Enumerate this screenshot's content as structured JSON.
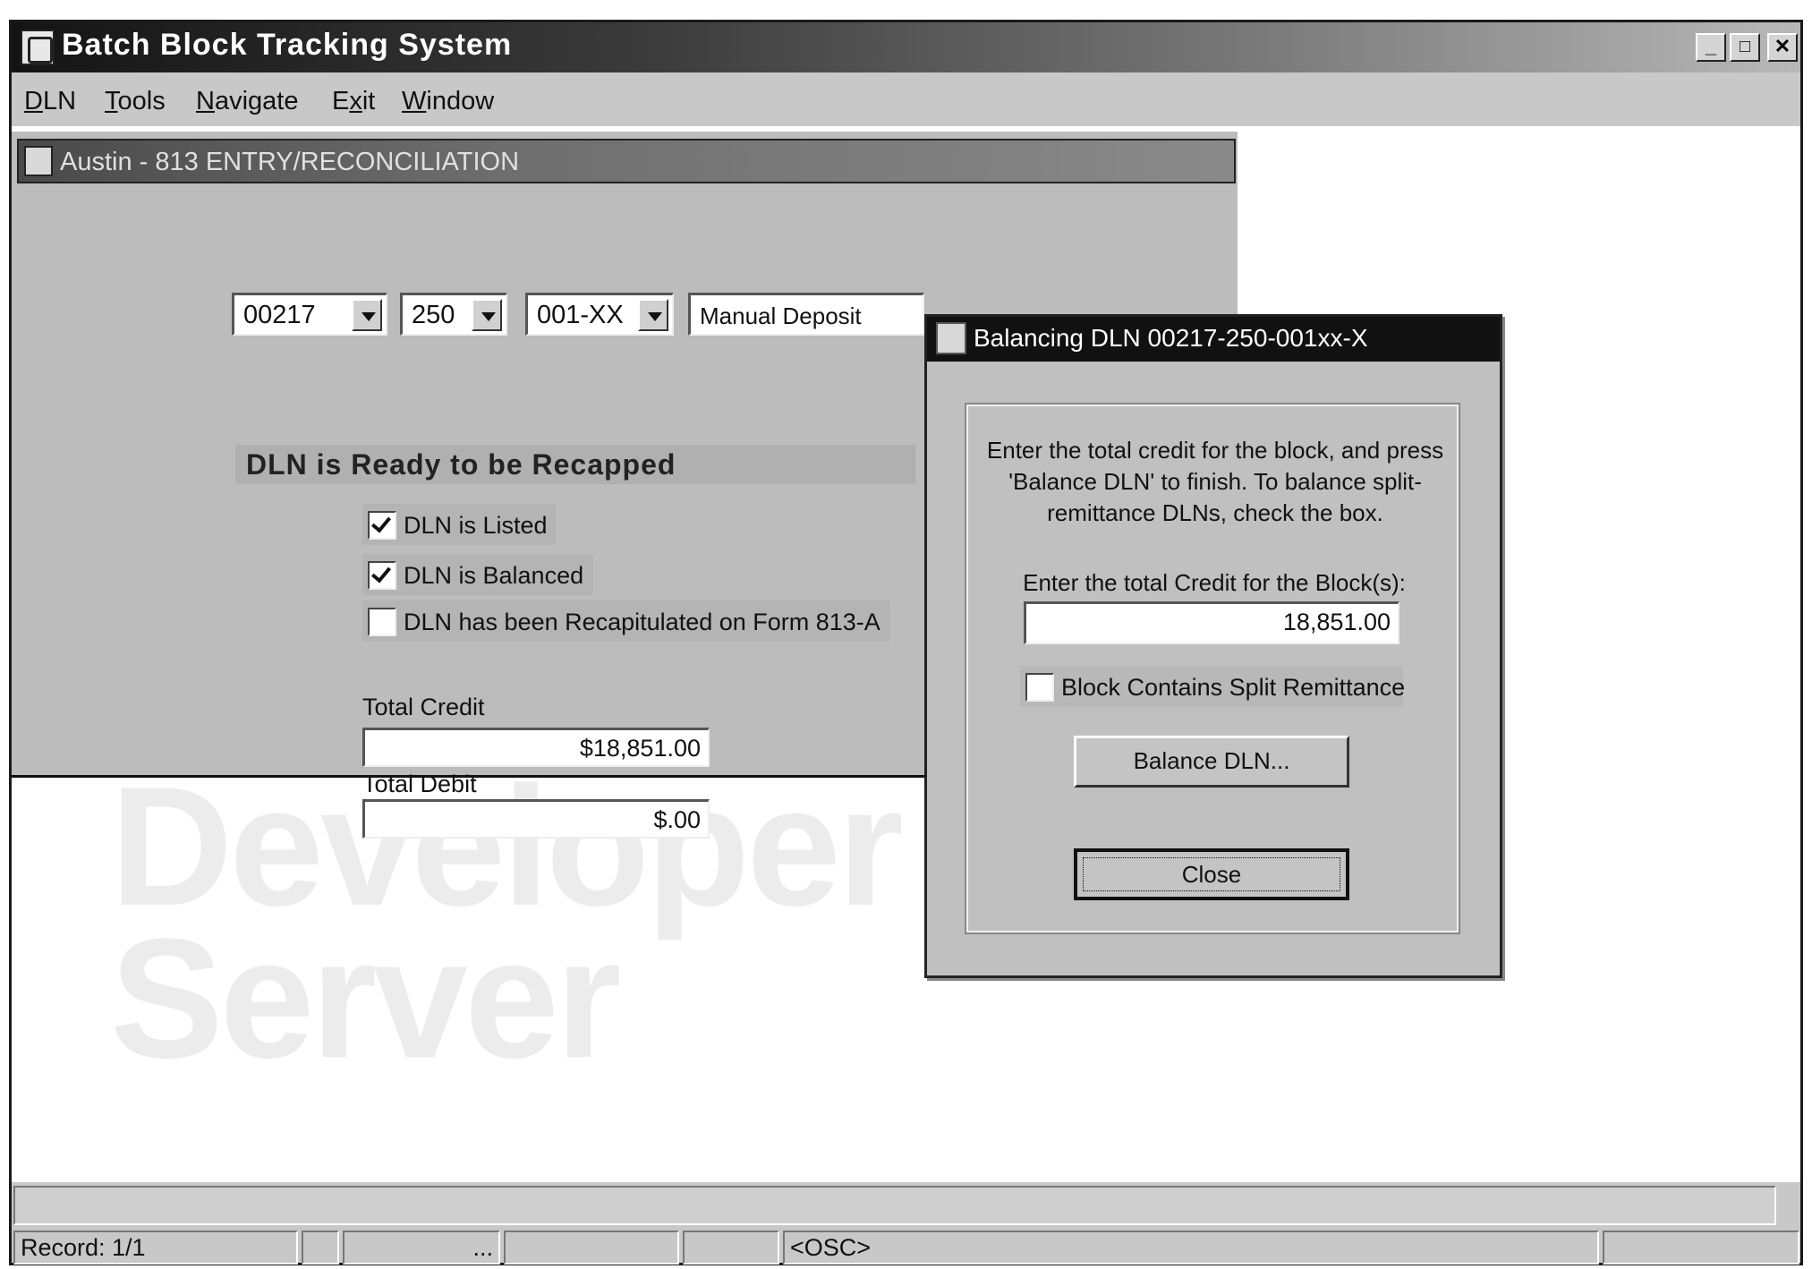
{
  "app": {
    "title": "Batch Block Tracking System",
    "window_buttons": {
      "minimize": "_",
      "maximize": "□",
      "close": "✕"
    }
  },
  "menu": [
    {
      "label": "DLN",
      "accel": "D",
      "rest": "LN"
    },
    {
      "label": "Tools",
      "accel": "T",
      "rest": "ools"
    },
    {
      "label": "Navigate",
      "accel": "N",
      "rest": "avigate"
    },
    {
      "label": "Exit",
      "pre": "E",
      "accel": "x",
      "rest": "it"
    },
    {
      "label": "Window",
      "accel": "W",
      "rest": "indow"
    }
  ],
  "watermark": {
    "line1": "Developer",
    "line2": "Server"
  },
  "inner_window": {
    "title": "Austin - 813 ENTRY/RECONCILIATION",
    "combo_1": "00217",
    "combo_2": "250",
    "combo_3": "001-XX",
    "deposit_type": "Manual Deposit",
    "status_heading": "DLN is Ready to be Recapped",
    "checkboxes": [
      {
        "label": "DLN is Listed",
        "checked": true
      },
      {
        "label": "DLN is Balanced",
        "checked": true
      },
      {
        "label": "DLN has been Recapitulated on Form 813-A",
        "checked": false
      }
    ],
    "total_credit_label": "Total Credit",
    "total_credit_value": "$18,851.00",
    "total_debit_label": "Total Debit",
    "total_debit_value": "$.00"
  },
  "dialog": {
    "title": "Balancing DLN 00217-250-001xx-X",
    "instructions": "Enter the total credit for the block, and press 'Balance DLN' to finish. To balance split-remittance DLNs, check the box.",
    "credit_prompt": "Enter the total Credit for the Block(s):",
    "credit_value": "18,851.00",
    "split_label": "Block Contains Split Remittance",
    "split_checked": false,
    "balance_button": "Balance DLN...",
    "close_button": "Close"
  },
  "statusbar": {
    "record": "Record: 1/1",
    "ellipsis": "...",
    "osc": "<OSC>"
  }
}
